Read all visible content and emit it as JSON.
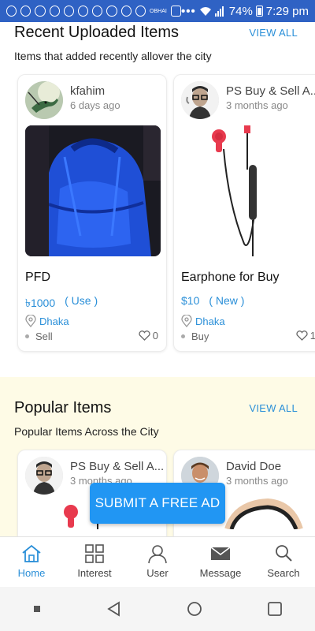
{
  "status_bar": {
    "network_label": "OBHAI",
    "battery": "74%",
    "time": "7:29 pm"
  },
  "recent": {
    "title": "Recent Uploaded Items",
    "view_all": "VIEW ALL",
    "subtitle": "Items that added recently allover the city",
    "cards": [
      {
        "user": "kfahim",
        "time": "6 days ago",
        "title": "PFD",
        "price": "৳1000",
        "condition": "( Use )",
        "location": "Dhaka",
        "type": "Sell",
        "likes": "0"
      },
      {
        "user": "PS Buy & Sell A...",
        "time": "3 months ago",
        "title": "Earphone for Buy",
        "price": "$10",
        "condition": "( New )",
        "location": "Dhaka",
        "type": "Buy",
        "likes": "1"
      }
    ]
  },
  "popular": {
    "title": "Popular Items",
    "view_all": "VIEW ALL",
    "subtitle": "Popular Items Across the City",
    "cards": [
      {
        "user": "PS Buy & Sell A...",
        "time": "3 months ago"
      },
      {
        "user": "David Doe",
        "time": "3 months ago"
      }
    ]
  },
  "submit_button": "SUBMIT A FREE AD",
  "bottom_nav": [
    {
      "label": "Home",
      "icon": "home-icon",
      "active": true
    },
    {
      "label": "Interest",
      "icon": "grid-icon",
      "active": false
    },
    {
      "label": "User",
      "icon": "user-icon",
      "active": false
    },
    {
      "label": "Message",
      "icon": "envelope-icon",
      "active": false
    },
    {
      "label": "Search",
      "icon": "search-icon",
      "active": false
    }
  ],
  "colors": {
    "accent": "#2a8fd8",
    "button": "#2196f3",
    "status_bar": "#2f62c4",
    "popular_bg": "#fefbe6"
  }
}
